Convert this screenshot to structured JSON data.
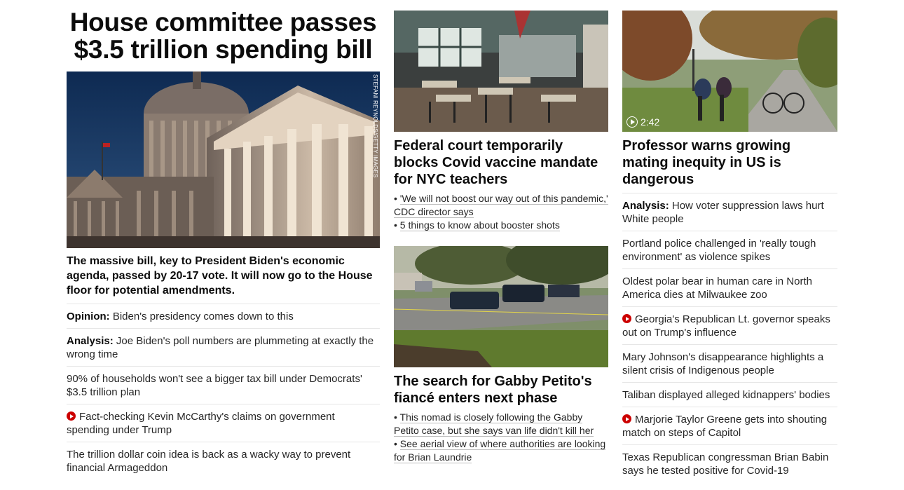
{
  "lead": {
    "headline": "House committee passes $3.5 trillion spending bill",
    "photo_credit": "STEFANI REYNOLDS/GETTY IMAGES",
    "summary": "The massive bill, key to President Biden's economic agenda, passed by 20-17 vote. It will now go to the House floor for potential amendments.",
    "related": [
      {
        "kicker": "Opinion:",
        "text": "Biden's presidency comes down to this",
        "video": false
      },
      {
        "kicker": "Analysis:",
        "text": "Joe Biden's poll numbers are plummeting at exactly the wrong time",
        "video": false
      },
      {
        "kicker": "",
        "text": "90% of households won't see a bigger tax bill under Democrats' $3.5 trillion plan",
        "video": false
      },
      {
        "kicker": "",
        "text": "Fact-checking Kevin McCarthy's claims on government spending under Trump",
        "video": true
      },
      {
        "kicker": "",
        "text": "The trillion dollar coin idea is back as a wacky way to prevent financial Armageddon",
        "video": false
      }
    ]
  },
  "middle": {
    "story1": {
      "headline": "Federal court temporarily blocks Covid vaccine mandate for NYC teachers",
      "bullets": [
        "'We will not boost our way out of this pandemic,' CDC director says",
        "5 things to know about booster shots"
      ]
    },
    "story2": {
      "headline": "The search for Gabby Petito's fiancé enters next phase",
      "bullets": [
        "This nomad is closely following the Gabby Petito case, but she says van life didn't kill her",
        "See aerial view of where authorities are looking for Brian Laundrie"
      ]
    }
  },
  "right": {
    "video_duration": "2:42",
    "headline": "Professor warns growing mating inequity in US is dangerous",
    "items": [
      {
        "kicker": "Analysis:",
        "text": "How voter suppression laws hurt White people",
        "video": false
      },
      {
        "kicker": "",
        "text": "Portland police challenged in 'really tough environment' as violence spikes",
        "video": false
      },
      {
        "kicker": "",
        "text": "Oldest polar bear in human care in North America dies at Milwaukee zoo",
        "video": false
      },
      {
        "kicker": "",
        "text": "Georgia's Republican Lt. governor speaks out on Trump's influence",
        "video": true
      },
      {
        "kicker": "",
        "text": "Mary Johnson's disappearance highlights a silent crisis of Indigenous people",
        "video": false
      },
      {
        "kicker": "",
        "text": "Taliban displayed alleged kidnappers' bodies",
        "video": false
      },
      {
        "kicker": "",
        "text": "Marjorie Taylor Greene gets into shouting match on steps of Capitol",
        "video": true
      },
      {
        "kicker": "",
        "text": "Texas Republican congressman Brian Babin says he tested positive for Covid-19",
        "video": false
      }
    ]
  },
  "colors": {
    "video_red": "#cc0000",
    "text": "#262626",
    "divider": "#e6e6e6"
  }
}
